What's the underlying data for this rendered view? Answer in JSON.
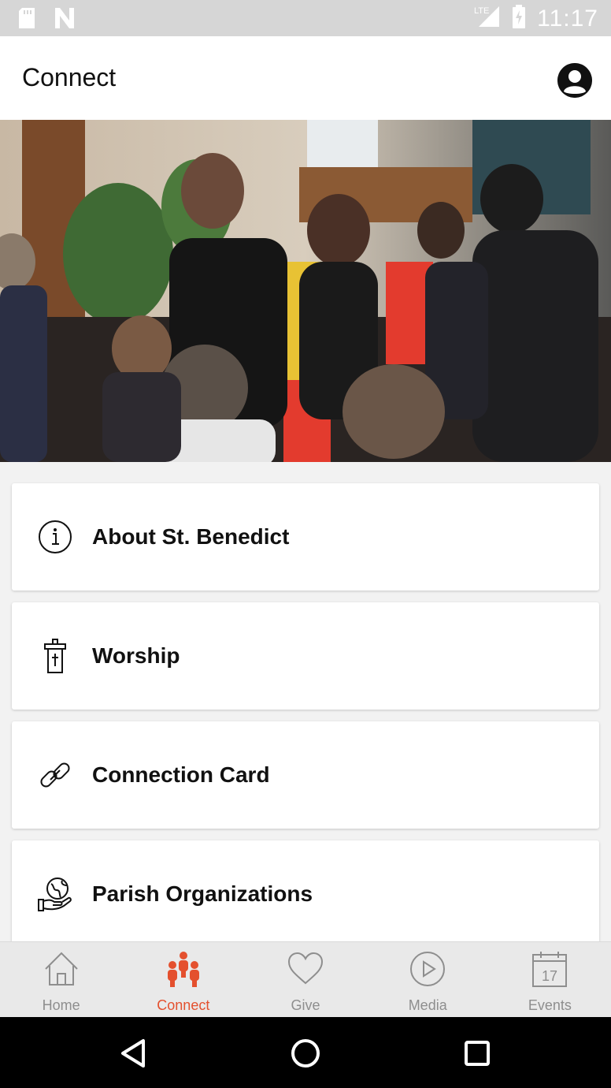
{
  "status_bar": {
    "time": "11:17",
    "network": "LTE",
    "icons": [
      "sd-card-icon",
      "notification-n-icon",
      "signal-icon",
      "battery-charging-icon"
    ]
  },
  "header": {
    "title": "Connect",
    "profile_icon": "profile-icon"
  },
  "hero": {
    "description": "photo"
  },
  "menu": [
    {
      "label": "About St. Benedict",
      "icon": "info-icon"
    },
    {
      "label": "Worship",
      "icon": "altar-cross-icon"
    },
    {
      "label": "Connection Card",
      "icon": "link-icon"
    },
    {
      "label": "Parish Organizations",
      "icon": "globe-hand-icon"
    }
  ],
  "tabs": [
    {
      "label": "Home",
      "icon": "home-icon",
      "active": false
    },
    {
      "label": "Connect",
      "icon": "people-icon",
      "active": true
    },
    {
      "label": "Give",
      "icon": "heart-icon",
      "active": false
    },
    {
      "label": "Media",
      "icon": "play-circle-icon",
      "active": false
    },
    {
      "label": "Events",
      "icon": "calendar-icon",
      "active": false,
      "calendar_day": "17"
    }
  ],
  "colors": {
    "accent": "#e4502e",
    "inactive": "#8e8e8e",
    "status_bar": "#d6d6d6",
    "nav_bar": "#000000"
  }
}
